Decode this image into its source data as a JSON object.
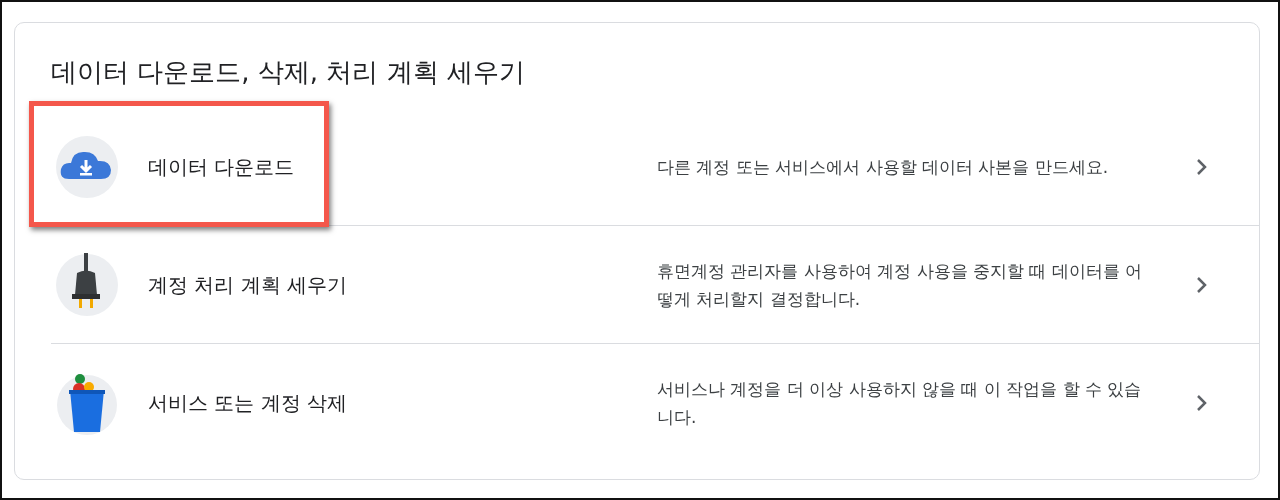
{
  "section": {
    "title": "데이터 다운로드, 삭제, 처리 계획 세우기"
  },
  "items": [
    {
      "kind": "download",
      "label": "데이터 다운로드",
      "description": "다른 계정 또는 서비스에서 사용할 데이터 사본을 만드세요.",
      "highlighted": true
    },
    {
      "kind": "plan",
      "label": "계정 처리 계획 세우기",
      "description": "휴면계정 관리자를 사용하여 계정 사용을 중지할 때 데이터를 어떻게 처리할지 결정합니다.",
      "highlighted": false
    },
    {
      "kind": "delete",
      "label": "서비스 또는 계정 삭제",
      "description": "서비스나 계정을 더 이상 사용하지 않을 때 이 작업을 할 수 있습니다.",
      "highlighted": false
    }
  ]
}
